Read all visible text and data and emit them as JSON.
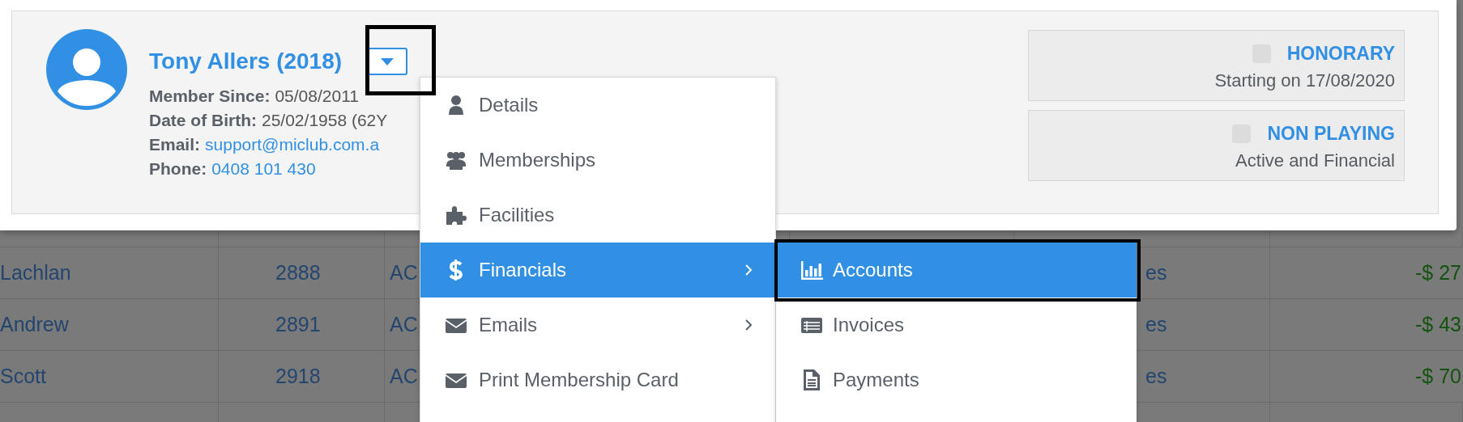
{
  "member": {
    "name": "Tony Allers (2018)",
    "details": [
      {
        "label": "Member Since:",
        "value": "05/08/2011",
        "kind": "text"
      },
      {
        "label": "Date of Birth:",
        "value": "25/02/1958 (62Y",
        "kind": "text"
      },
      {
        "label": "Email:",
        "value": "support@miclub.com.a",
        "kind": "link"
      },
      {
        "label": "Phone:",
        "value": "0408 101 430",
        "kind": "link"
      }
    ]
  },
  "statuses": [
    {
      "title": "HONORARY",
      "checked": false,
      "subtitle": "Starting on 17/08/2020"
    },
    {
      "title": "NON PLAYING",
      "checked": false,
      "subtitle": "Active and Financial"
    }
  ],
  "menu": {
    "items": [
      {
        "label": "Details",
        "selected": false,
        "has_submenu": false
      },
      {
        "label": "Memberships",
        "selected": false,
        "has_submenu": false
      },
      {
        "label": "Facilities",
        "selected": false,
        "has_submenu": false
      },
      {
        "label": "Financials",
        "selected": true,
        "has_submenu": true
      },
      {
        "label": "Emails",
        "selected": false,
        "has_submenu": true
      },
      {
        "label": "Print Membership Card",
        "selected": false,
        "has_submenu": false
      }
    ]
  },
  "submenu": {
    "items": [
      {
        "label": "Accounts",
        "selected": true
      },
      {
        "label": "Invoices",
        "selected": false
      },
      {
        "label": "Payments",
        "selected": false
      }
    ]
  },
  "table": {
    "rows": [
      {
        "name": "Lachlan",
        "number": "2888",
        "column_3": "AC",
        "column_5": "es",
        "column_6": "-$ 27"
      },
      {
        "name": "Andrew",
        "number": "2891",
        "column_3": "AC",
        "column_5": "es",
        "column_6": "-$ 43"
      },
      {
        "name": "Scott",
        "number": "2918",
        "column_3": "AC",
        "column_5": "es",
        "column_6": "-$ 70"
      }
    ]
  }
}
